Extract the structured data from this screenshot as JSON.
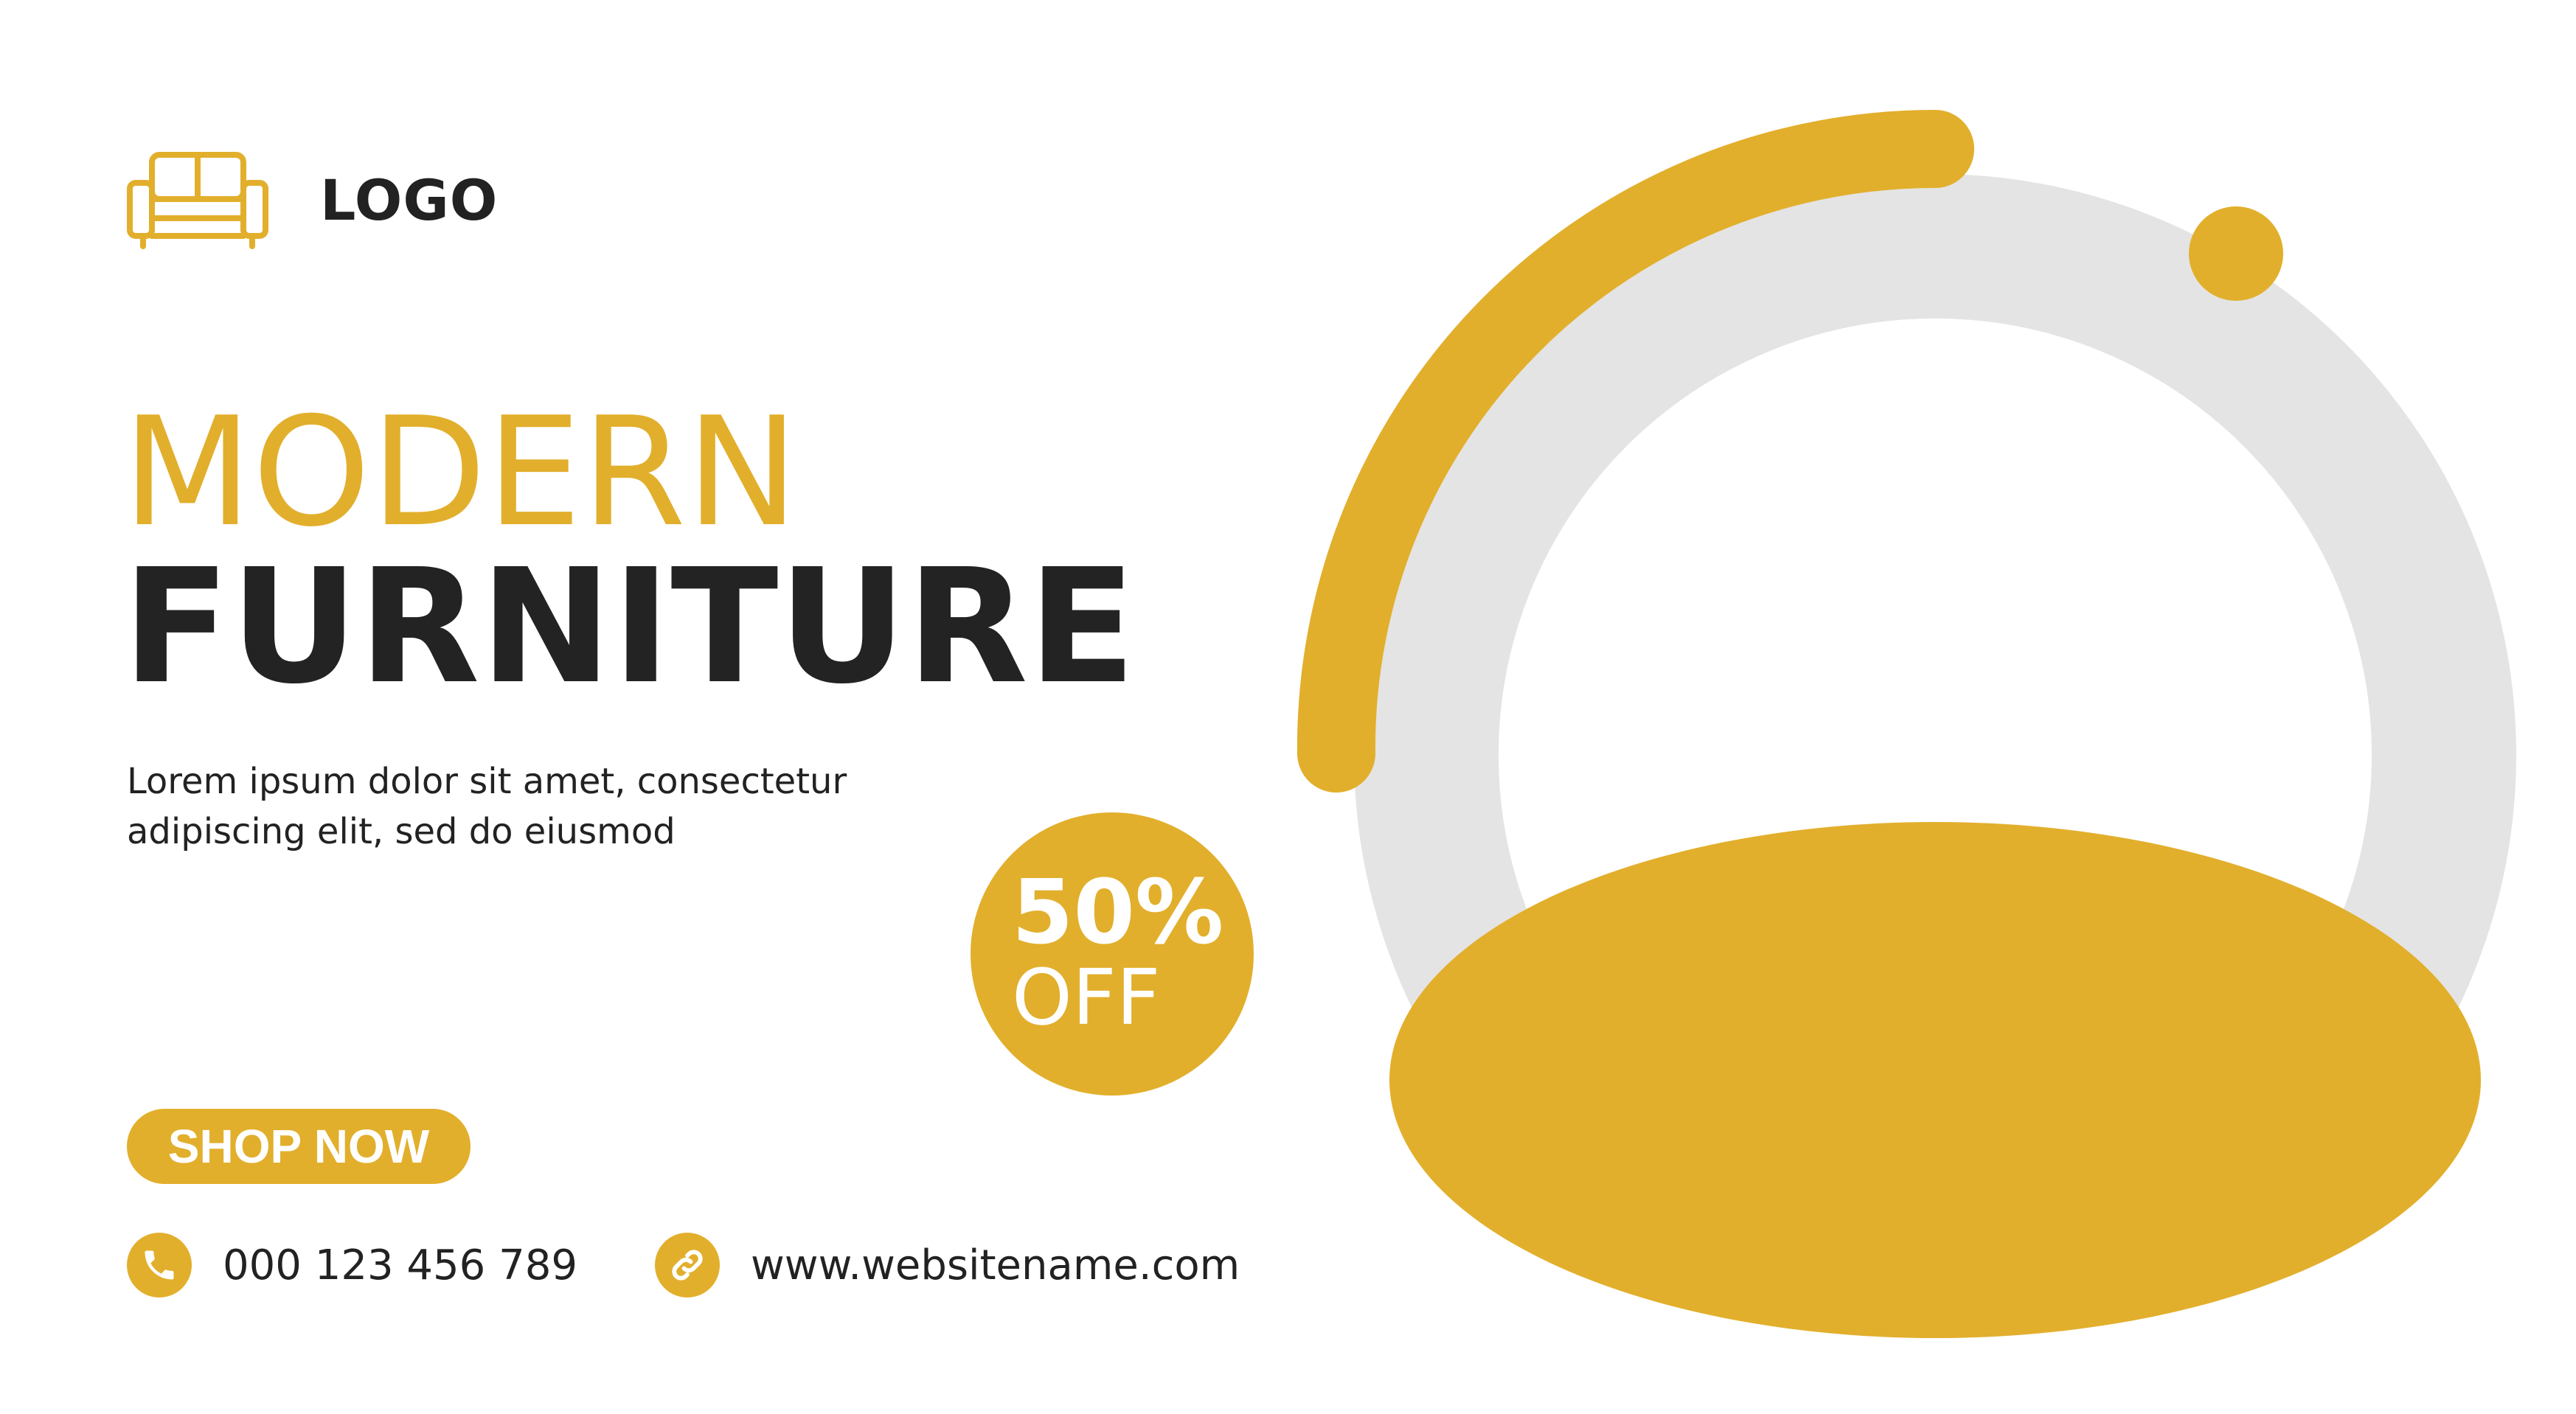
{
  "brand": {
    "logo_text": "LOGO",
    "logo_icon": "sofa-icon"
  },
  "headline": {
    "line1": "MODERN",
    "line2": "FURNITURE"
  },
  "description": {
    "line1": "Lorem ipsum dolor sit amet, consectetur",
    "line2": "adipiscing elit, sed do eiusmod"
  },
  "promo": {
    "value": "50%",
    "label": "OFF"
  },
  "cta": {
    "label": "SHOP NOW"
  },
  "contact": {
    "phone": "000 123 456 789",
    "phone_icon": "phone-icon",
    "website": "www.websitename.com",
    "website_icon": "link-icon"
  },
  "colors": {
    "accent": "#e2af2c",
    "text_dark": "#232323",
    "ring": "#e4e4e4",
    "background": "#ffffff"
  }
}
